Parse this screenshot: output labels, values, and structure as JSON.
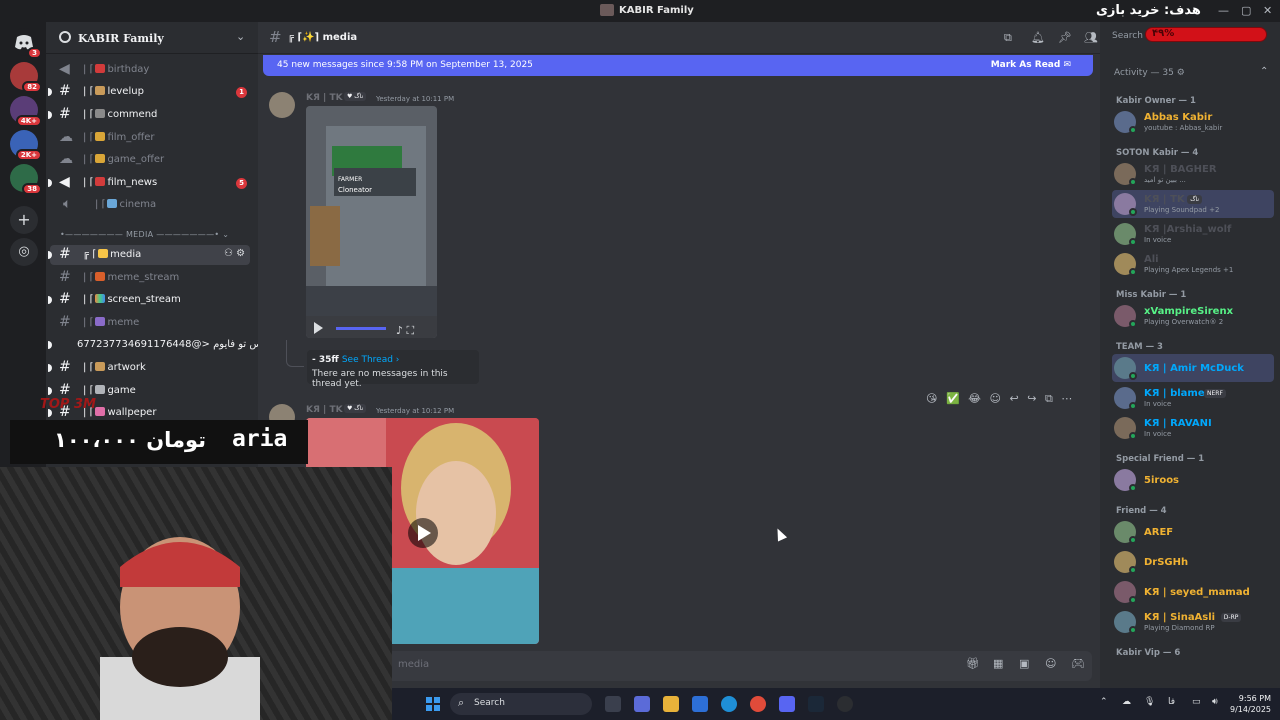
{
  "window": {
    "title": "KABIR Family"
  },
  "rail": {
    "servers": [
      {
        "badge": "3"
      },
      {
        "badge": "82"
      },
      {
        "badge": "4K+"
      },
      {
        "badge": "2K+"
      },
      {
        "badge": "38"
      }
    ]
  },
  "guild": {
    "name": "KABIR Family"
  },
  "channels": [
    {
      "label": "birthday"
    },
    {
      "label": "levelup",
      "badge": "1"
    },
    {
      "label": "commend"
    },
    {
      "label": "film_offer"
    },
    {
      "label": "game_offer"
    },
    {
      "label": "film_news",
      "badge": "5"
    },
    {
      "label": "cinema"
    },
    {
      "label": "media"
    },
    {
      "label": "meme_stream"
    },
    {
      "label": "screen_stream"
    },
    {
      "label": "meme"
    },
    {
      "label": "677237734691176448@> عباس تو فایوم"
    },
    {
      "label": "artwork"
    },
    {
      "label": "game"
    },
    {
      "label": "wallpeper"
    }
  ],
  "category": {
    "label": "MEDIA"
  },
  "channel_header": {
    "name": "media"
  },
  "new_messages": {
    "text": "45 new messages since 9:58 PM on September 13, 2025",
    "action": "Mark As Read"
  },
  "messages": [
    {
      "author": "KЯ | TK",
      "tag": "ناگ",
      "time": "Yesterday at 10:11 PM"
    },
    {
      "author": "KЯ | TK",
      "tag": "ناگ",
      "time": "Yesterday at 10:12 PM"
    }
  ],
  "thread": {
    "name": "- 35ff",
    "see": "See Thread ›",
    "empty": "There are no messages in this thread yet."
  },
  "composer": {
    "placeholder": "media"
  },
  "overlay": {
    "amount": "۱۰۰،۰۰۰ تومان",
    "donor": "aria",
    "top_mark": "TOP 3M",
    "goal_label": "هدف: خرید بازی",
    "goal_value": "۴۹%",
    "goal_progress": 0.49
  },
  "members": {
    "search_placeholder": "Search",
    "activity": "Activity — 35",
    "groups": [
      {
        "title": "Kabir Owner — 1",
        "items": [
          {
            "name": "Abbas Kabir",
            "status": "youtube : Abbas_kabir",
            "color": "#f0b232"
          }
        ]
      },
      {
        "title": "SOTON Kabir — 4",
        "items": [
          {
            "name": "KЯ | BAGHER",
            "status": "ببین تو امید ...",
            "color": "#4e5058"
          },
          {
            "name": "KЯ | TK",
            "tag": "ناگ",
            "status": "Playing Soundpad +2",
            "color": "#4e5058"
          },
          {
            "name": "KЯ |Arshia_wolf",
            "status": "In voice",
            "color": "#4e5058"
          },
          {
            "name": "Ali",
            "status": "Playing Apex Legends +1",
            "color": "#4e5058"
          }
        ]
      },
      {
        "title": "Miss Kabir — 1",
        "items": [
          {
            "name": "xVampireSirenx",
            "status": "Playing Overwatch® 2",
            "color": "#57f287"
          }
        ]
      },
      {
        "title": "TEAM — 3",
        "items": [
          {
            "name": "KЯ | Amir McDuck",
            "status": "",
            "color": "#00a8fc"
          },
          {
            "name": "KЯ | blame",
            "tag": "NERF",
            "status": "In voice",
            "color": "#00a8fc"
          },
          {
            "name": "KЯ | RAVANI",
            "status": "In voice",
            "color": "#00a8fc"
          }
        ]
      },
      {
        "title": "Special Friend — 1",
        "items": [
          {
            "name": "5iroos",
            "status": "",
            "color": "#f0b232"
          }
        ]
      },
      {
        "title": "Friend — 4",
        "items": [
          {
            "name": "AREF",
            "status": "",
            "color": "#f0b232"
          },
          {
            "name": "DrSGHh",
            "status": "",
            "color": "#f0b232"
          },
          {
            "name": "KЯ | seyed_mamad",
            "status": "",
            "color": "#f0b232"
          },
          {
            "name": "KЯ | SinaAsli",
            "tag": "D-RP",
            "status": "Playing Diamond RP",
            "color": "#f0b232"
          }
        ]
      },
      {
        "title": "Kabir Vip — 6",
        "items": []
      }
    ]
  },
  "taskbar": {
    "search": "Search",
    "time": "9:56 PM",
    "date": "9/14/2025",
    "lang": "فا"
  },
  "colors": {
    "accent": "#5865f2",
    "bg": "#313338",
    "sidebar": "#2b2d31"
  }
}
